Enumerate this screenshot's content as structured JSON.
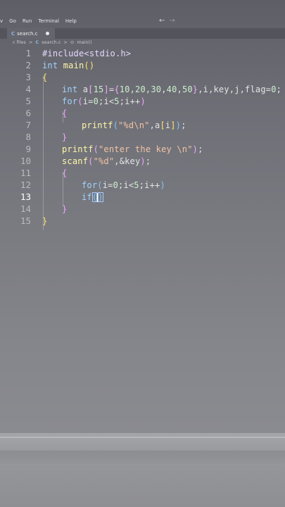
{
  "menu": [
    "v",
    "Go",
    "Run",
    "Terminal",
    "Help"
  ],
  "nav": {
    "back": "←",
    "forward": "→"
  },
  "tab": {
    "icon": "C",
    "label": "search.c"
  },
  "breadcrumb": {
    "folder": "c files",
    "sep1": ">",
    "file_icon": "C",
    "file": "search.c",
    "sep2": ">",
    "symbol_icon": "⊙",
    "symbol": "main()"
  },
  "editor": {
    "line_numbers": [
      "1",
      "2",
      "3",
      "4",
      "5",
      "6",
      "7",
      "8",
      "9",
      "10",
      "11",
      "12",
      "13",
      "14",
      "15"
    ],
    "tokens": {
      "l1_inc": "#include",
      "l1_hdr": "<stdio.h>",
      "l2_kw": "int",
      "l2_fn": "main",
      "l2_p": "()",
      "l3": "{",
      "l4_kw": "int",
      "l4_a": " a",
      "l4_lb": "[",
      "l4_n15": "15",
      "l4_rb": "]",
      "l4_eq": "=",
      "l4_lc": "{",
      "l4_vals_1": "10",
      "l4_c1": ",",
      "l4_vals_2": "20",
      "l4_c2": ",",
      "l4_vals_3": "30",
      "l4_c3": ",",
      "l4_vals_4": "40",
      "l4_c4": ",",
      "l4_vals_5": "50",
      "l4_rc": "}",
      "l4_rest": ",i,key,j,flag=",
      "l4_zero": "0",
      "l4_semi": ";",
      "l5_kw": "for",
      "l5_lp": "(",
      "l5_body1": "i=",
      "l5_z": "0",
      "l5_body2": ";i<",
      "l5_five": "5",
      "l5_body3": ";i++",
      "l5_rp": ")",
      "l6": "{",
      "l7_fn": "printf",
      "l7_lp": "(",
      "l7_str": "\"%d\\n\"",
      "l7_mid": ",a",
      "l7_lb": "[",
      "l7_i": "i",
      "l7_rb": "]",
      "l7_rp": ")",
      "l7_semi": ";",
      "l8": "}",
      "l9_fn": "printf",
      "l9_lp": "(",
      "l9_str": "\"enter the key \\n\"",
      "l9_rp": ")",
      "l9_semi": ";",
      "l10_fn": "scanf",
      "l10_lp": "(",
      "l10_str": "\"%d\"",
      "l10_mid": ",&key",
      "l10_rp": ")",
      "l10_semi": ";",
      "l11": "{",
      "l12_kw": "for",
      "l12_lp": "(",
      "l12_body1": "i=",
      "l12_z": "0",
      "l12_body2": ";i<",
      "l12_five": "5",
      "l12_body3": ";i++",
      "l12_rp": ")",
      "l13_kw": "if",
      "l13_lp": "(",
      "l13_rp": ")",
      "l14": "}",
      "l15": "}"
    }
  }
}
